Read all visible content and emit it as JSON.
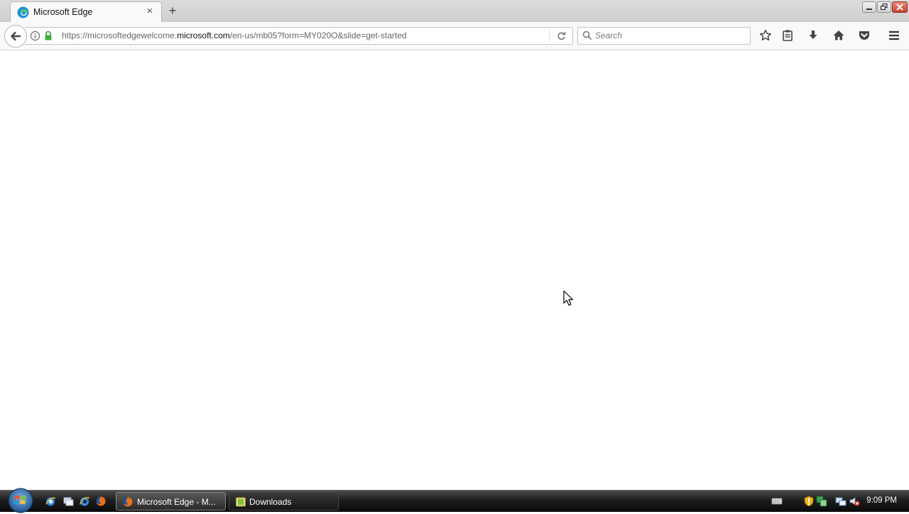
{
  "browser": {
    "tab": {
      "title": "Microsoft Edge",
      "close_label": "×"
    },
    "new_tab_label": "+",
    "address": {
      "url_prefix": "https://microsoftedgewelcome.",
      "url_domain": "microsoft.com",
      "url_path": "/en-us/mb05?form=MY020O&slide=get-started"
    },
    "search": {
      "placeholder": "Search",
      "value": ""
    },
    "toolbar_icons": [
      "bookmark-star-icon",
      "reading-list-icon",
      "downloads-icon",
      "home-icon",
      "pocket-icon",
      "menu-icon"
    ]
  },
  "taskbar": {
    "quick_launch": [
      "ie-icon",
      "show-desktop-icon",
      "ie-blue-icon",
      "firefox-icon"
    ],
    "tasks": [
      {
        "label": "Microsoft Edge - M...",
        "icon": "firefox-icon",
        "active": true
      },
      {
        "label": "Downloads",
        "icon": "folder-icon",
        "active": false
      }
    ],
    "tray_icons": [
      "keyboard-icon",
      "security-shield-icon",
      "network-status-icon",
      "network-icon",
      "volume-muted-icon"
    ],
    "clock": "9:09 PM"
  },
  "colors": {
    "accent_green_lock": "#3fae3f",
    "taskbar": "#1d1d1d",
    "edge_blue": "#1e8fd8"
  }
}
